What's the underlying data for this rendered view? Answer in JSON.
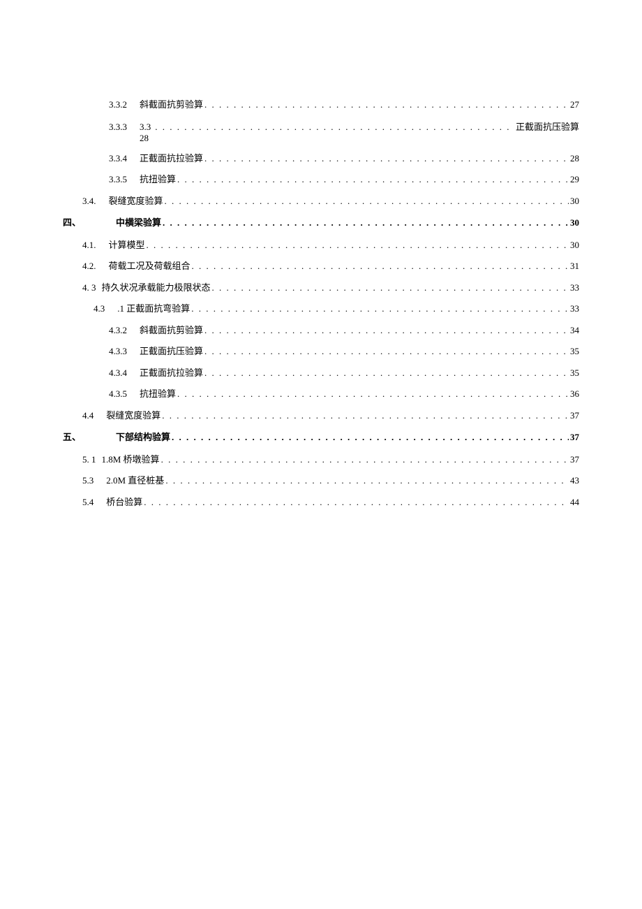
{
  "entries": [
    {
      "num": "3.3.2",
      "title": "斜截面抗剪验算",
      "page": "27",
      "indent": 3,
      "bold": false
    },
    {
      "special": "333",
      "num1": "3.3.3",
      "num2": "3.3",
      "title": "正截面抗压验算",
      "page": "28",
      "indent": 3
    },
    {
      "num": "3.3.4",
      "title": "正截面抗拉验算",
      "page": "28",
      "indent": 3,
      "bold": false
    },
    {
      "num": "3.3.5",
      "title": "抗扭验算",
      "page": "29",
      "indent": 3,
      "bold": false
    },
    {
      "num": "3.4.",
      "title": "裂缝宽度验算",
      "page": "30",
      "indent": 1,
      "bold": false
    },
    {
      "num": "四、",
      "title": "中横梁验算",
      "page": "30",
      "indent": 0,
      "bold": true,
      "numPad": 50
    },
    {
      "num": "4.1.",
      "title": "计算模型",
      "page": "30",
      "indent": 1,
      "bold": false
    },
    {
      "num": "4.2.",
      "title": "荷载工况及荷载组合",
      "page": "31",
      "indent": 1,
      "bold": false
    },
    {
      "num": "4.   3",
      "title": "持久状况承载能力极限状态",
      "page": "33",
      "indent": 1,
      "bold": false,
      "noGap": true
    },
    {
      "num": "4.3",
      "title": ".1 正截面抗弯验算",
      "page": "33",
      "indent": 2,
      "bold": false
    },
    {
      "num": "4.3.2",
      "title": "斜截面抗剪验算",
      "page": "34",
      "indent": 3,
      "bold": false
    },
    {
      "num": "4.3.3",
      "title": "正截面抗压验算",
      "page": "35",
      "indent": 3,
      "bold": false
    },
    {
      "num": "4.3.4",
      "title": "正截面抗拉验算",
      "page": "35",
      "indent": 3,
      "bold": false
    },
    {
      "num": "4.3.5",
      "title": "抗扭验算",
      "page": "36",
      "indent": 3,
      "bold": false
    },
    {
      "num": "4.4",
      "title": "裂缝宽度验算",
      "page": "37",
      "indent": 1,
      "bold": false
    },
    {
      "num": "五、",
      "title": "下部结构验算",
      "page": "37",
      "indent": 0,
      "bold": true,
      "numPad": 50,
      "titlePartial": "下部结",
      "titleBoldPart": "构验算"
    },
    {
      "num": "5.   1",
      "title": "1.8M 桥墩验算",
      "page": "37",
      "indent": 1,
      "bold": false,
      "noGap": true
    },
    {
      "num": "5.3",
      "title": "2.0M 直径桩基",
      "page": "43",
      "indent": 1,
      "bold": false
    },
    {
      "num": "5.4",
      "title": "桥台验算",
      "page": "44",
      "indent": 1,
      "bold": false
    }
  ],
  "leader": ". . . . . . . . . . . . . . . . . . . . . . . . . . . . . . . . . . . . . . . . . . . . . . . . . . . . . . . . . . . . . . . . . . . . . . . . . . . . . . . . . . . . . . . . . . . . . . . . . . . . . . . . . . . . . . . . . . . . . . . . . . . . . . . . . . . . . . . . . . . . . . . . . . . . . . . . . . ."
}
